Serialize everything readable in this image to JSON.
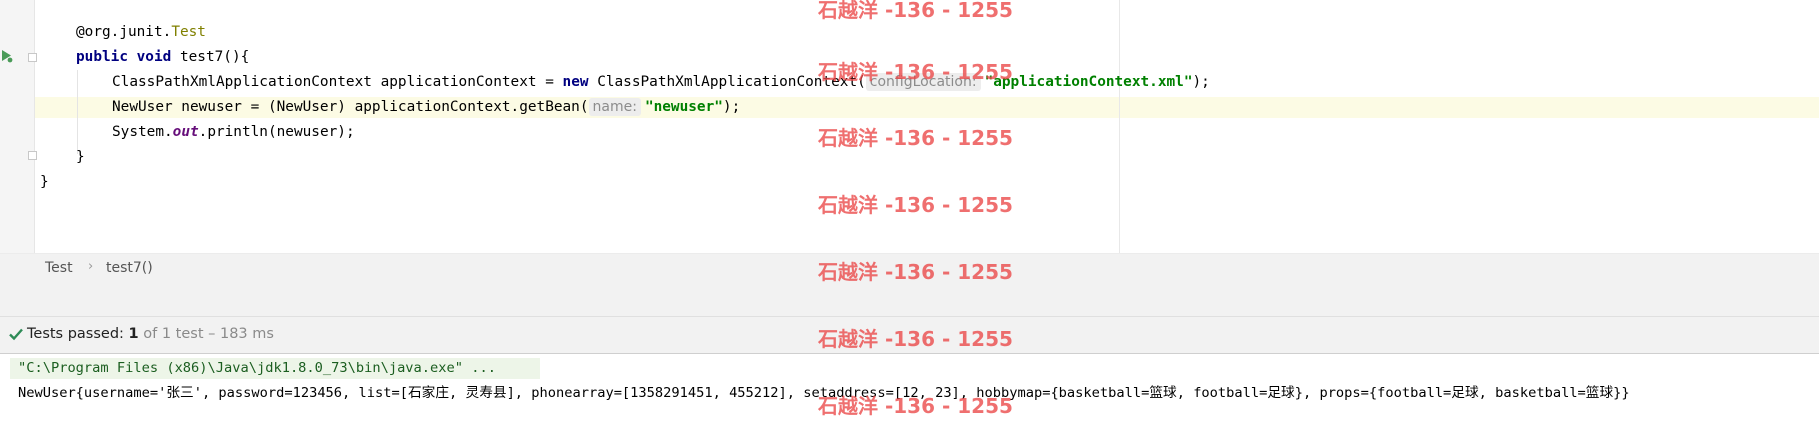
{
  "editor": {
    "lines": {
      "annotation_prefix": "@org.junit.",
      "annotation_name": "Test",
      "decl_kw": "public void",
      "decl_rest": " test7(){",
      "line3_pre": "ClassPathXmlApplicationContext applicationContext = ",
      "line3_kw": "new",
      "line3_mid": " ClassPathXmlApplicationContext(",
      "line3_hint": "configLocation:",
      "line3_str": "\"applicationContext.xml\"",
      "line3_end": ");",
      "line4_pre": "NewUser newuser = (NewUser) applicationContext.getBean(",
      "line4_hint": "name:",
      "line4_str": "\"newuser\"",
      "line4_end": ");",
      "line5_pre": "System.",
      "line5_field": "out",
      "line5_end": ".println(newuser);",
      "close_method": "}",
      "close_class": "}"
    }
  },
  "breadcrumb": {
    "items": [
      "Test",
      "test7()"
    ],
    "separator": "›"
  },
  "status": {
    "label": "Tests passed:",
    "count": "1",
    "detail": "of 1 test – 183 ms",
    "icon": "check-icon",
    "accent": "#2e8b57"
  },
  "console": {
    "command": "\"C:\\Program Files (x86)\\Java\\jdk1.8.0_73\\bin\\java.exe\" ...",
    "output": "NewUser{username='张三', password=123456, list=[石家庄, 灵寿县], phonearray=[1358291451, 455212], setaddress=[12, 23], hobbymap={basketball=篮球, football=足球}, props={football=足球, basketball=篮球}}"
  },
  "watermark": {
    "text": "石越洋 -136 - 1255",
    "color": "#eb4646"
  }
}
